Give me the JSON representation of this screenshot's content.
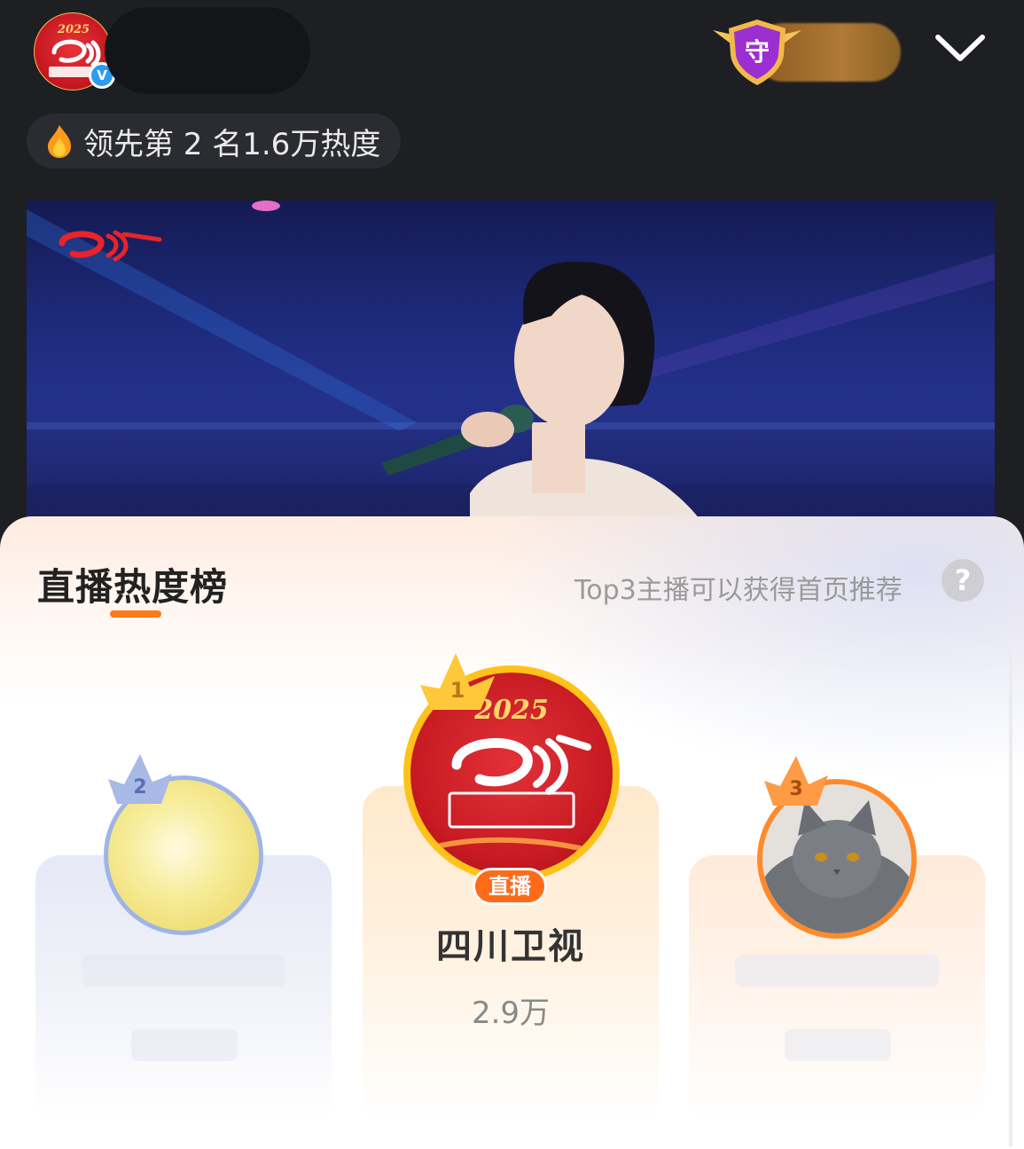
{
  "header": {
    "verified_mark": "V",
    "guard_badge_char": "守",
    "expand_icon": "chevron-down-icon"
  },
  "lead": {
    "icon": "flame-icon",
    "text": "领先第 2 名1.6万热度"
  },
  "ranking": {
    "title": "直播热度榜",
    "tip": "Top3主播可以获得首页推荐",
    "help_label": "?",
    "entries": [
      {
        "rank": "1",
        "name": "四川卫视",
        "score": "2.9万",
        "status": "直播"
      },
      {
        "rank": "2"
      },
      {
        "rank": "3"
      }
    ]
  },
  "colors": {
    "accent": "#ff7a1a",
    "gold": "#ffc21a",
    "silver": "#9fb4e6",
    "bronze": "#ff8a2a"
  }
}
